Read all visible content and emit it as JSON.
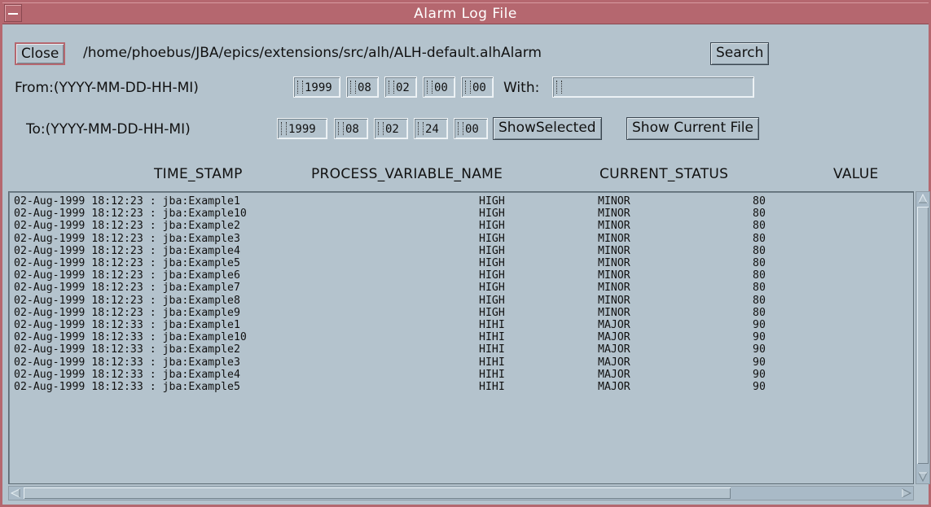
{
  "window": {
    "title": "Alarm Log File"
  },
  "toolbar": {
    "close_label": "Close",
    "file_path": "/home/phoebus/JBA/epics/extensions/src/alh/ALH-default.alhAlarm",
    "search_label": "Search"
  },
  "from": {
    "label": "From:(YYYY-MM-DD-HH-MI)",
    "year": "1999",
    "month": "08",
    "day": "02",
    "hour": "00",
    "minute": "00",
    "with_label": "With:",
    "with_value": ""
  },
  "to": {
    "label": "To:(YYYY-MM-DD-HH-MI)",
    "year": "1999",
    "month": "08",
    "day": "02",
    "hour": "24",
    "minute": "00",
    "show_selected_label": "ShowSelected",
    "show_current_label": "Show Current File"
  },
  "columns": {
    "time_stamp": "TIME_STAMP",
    "pv_name": "PROCESS_VARIABLE_NAME",
    "current_status": "CURRENT_STATUS",
    "value": "VALUE"
  },
  "log": [
    {
      "time": "02-Aug-1999 18:12:23 : jba:Example1",
      "cond": "HIGH",
      "sev": "MINOR",
      "val": "80"
    },
    {
      "time": "02-Aug-1999 18:12:23 : jba:Example10",
      "cond": "HIGH",
      "sev": "MINOR",
      "val": "80"
    },
    {
      "time": "02-Aug-1999 18:12:23 : jba:Example2",
      "cond": "HIGH",
      "sev": "MINOR",
      "val": "80"
    },
    {
      "time": "02-Aug-1999 18:12:23 : jba:Example3",
      "cond": "HIGH",
      "sev": "MINOR",
      "val": "80"
    },
    {
      "time": "02-Aug-1999 18:12:23 : jba:Example4",
      "cond": "HIGH",
      "sev": "MINOR",
      "val": "80"
    },
    {
      "time": "02-Aug-1999 18:12:23 : jba:Example5",
      "cond": "HIGH",
      "sev": "MINOR",
      "val": "80"
    },
    {
      "time": "02-Aug-1999 18:12:23 : jba:Example6",
      "cond": "HIGH",
      "sev": "MINOR",
      "val": "80"
    },
    {
      "time": "02-Aug-1999 18:12:23 : jba:Example7",
      "cond": "HIGH",
      "sev": "MINOR",
      "val": "80"
    },
    {
      "time": "02-Aug-1999 18:12:23 : jba:Example8",
      "cond": "HIGH",
      "sev": "MINOR",
      "val": "80"
    },
    {
      "time": "02-Aug-1999 18:12:23 : jba:Example9",
      "cond": "HIGH",
      "sev": "MINOR",
      "val": "80"
    },
    {
      "time": "02-Aug-1999 18:12:33 : jba:Example1",
      "cond": "HIHI",
      "sev": "MAJOR",
      "val": "90"
    },
    {
      "time": "02-Aug-1999 18:12:33 : jba:Example10",
      "cond": "HIHI",
      "sev": "MAJOR",
      "val": "90"
    },
    {
      "time": "02-Aug-1999 18:12:33 : jba:Example2",
      "cond": "HIHI",
      "sev": "MAJOR",
      "val": "90"
    },
    {
      "time": "02-Aug-1999 18:12:33 : jba:Example3",
      "cond": "HIHI",
      "sev": "MAJOR",
      "val": "90"
    },
    {
      "time": "02-Aug-1999 18:12:33 : jba:Example4",
      "cond": "HIHI",
      "sev": "MAJOR",
      "val": "90"
    },
    {
      "time": "02-Aug-1999 18:12:33 : jba:Example5",
      "cond": "HIHI",
      "sev": "MAJOR",
      "val": "90"
    }
  ],
  "colors": {
    "frame": "#b5676f",
    "background": "#b4c3cd",
    "text": "#111111"
  }
}
